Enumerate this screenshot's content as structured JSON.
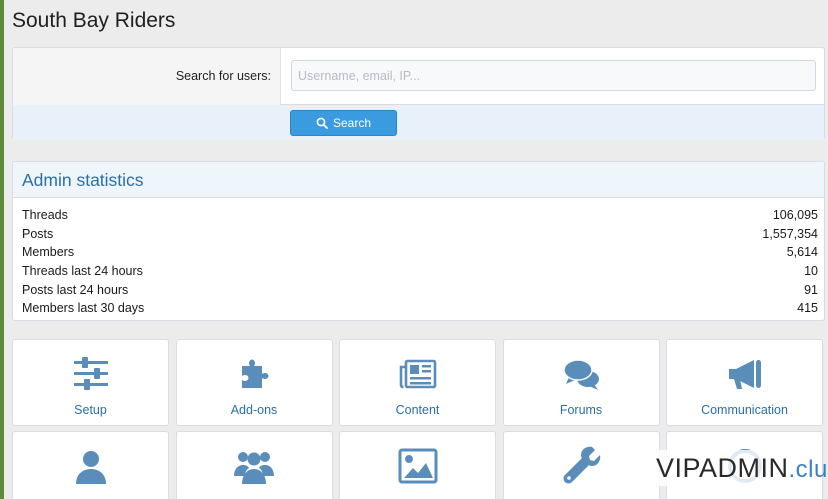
{
  "site": {
    "title": "South Bay Riders"
  },
  "search": {
    "label": "Search for users:",
    "placeholder": "Username, email, IP...",
    "value": "",
    "button_label": "Search"
  },
  "stats": {
    "title": "Admin statistics",
    "rows": [
      {
        "label": "Threads",
        "value": "106,095"
      },
      {
        "label": "Posts",
        "value": "1,557,354"
      },
      {
        "label": "Members",
        "value": "5,614"
      },
      {
        "label": "Threads last 24 hours",
        "value": "10"
      },
      {
        "label": "Posts last 24 hours",
        "value": "91"
      },
      {
        "label": "Members last 30 days",
        "value": "415"
      }
    ]
  },
  "tiles": [
    {
      "label": "Setup",
      "icon": "sliders-icon"
    },
    {
      "label": "Add-ons",
      "icon": "puzzle-icon"
    },
    {
      "label": "Content",
      "icon": "newspaper-icon"
    },
    {
      "label": "Forums",
      "icon": "chat-bubbles-icon"
    },
    {
      "label": "Communication",
      "icon": "megaphone-icon"
    },
    {
      "label": "",
      "icon": "user-icon"
    },
    {
      "label": "",
      "icon": "users-group-icon"
    },
    {
      "label": "",
      "icon": "image-icon"
    },
    {
      "label": "",
      "icon": "wrench-icon"
    },
    {
      "label": "",
      "icon": "circle-icon"
    }
  ],
  "watermark": {
    "main": "VIPADMIN",
    "sub": ".club"
  },
  "colors": {
    "accent": "#3a9be0",
    "link": "#2b6fa8",
    "icon": "#5b8dba"
  }
}
